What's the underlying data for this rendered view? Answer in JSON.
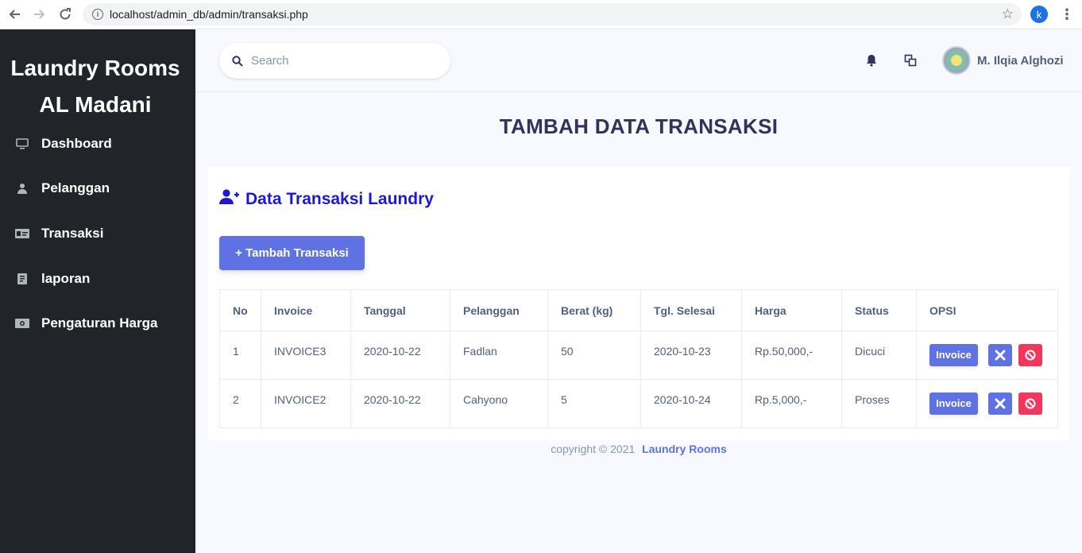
{
  "browser": {
    "url": "localhost/admin_db/admin/transaksi.php",
    "profile_initial": "k"
  },
  "sidebar": {
    "brand_line1": "Laundry Rooms",
    "brand_line2": "AL Madani",
    "items": [
      {
        "label": "Dashboard",
        "icon": "monitor-icon"
      },
      {
        "label": "Pelanggan",
        "icon": "user-icon"
      },
      {
        "label": "Transaksi",
        "icon": "money-card-icon"
      },
      {
        "label": "laporan",
        "icon": "report-icon"
      },
      {
        "label": "Pengaturan Harga",
        "icon": "cash-icon"
      }
    ]
  },
  "topbar": {
    "search_placeholder": "Search",
    "user_name": "M. Ilqia Alghozi"
  },
  "page_title": "TAMBAH DATA TRANSAKSI",
  "card": {
    "title": "Data Transaksi Laundry",
    "add_button": "+ Tambah Transaksi"
  },
  "table": {
    "headers": [
      "No",
      "Invoice",
      "Tanggal",
      "Pelanggan",
      "Berat (kg)",
      "Tgl. Selesai",
      "Harga",
      "Status",
      "OPSI"
    ],
    "rows": [
      {
        "no": "1",
        "invoice": "INVOICE3",
        "tanggal": "2020-10-22",
        "pelanggan": "Fadlan",
        "berat": "50",
        "tgl_selesai": "2020-10-23",
        "harga": "Rp.50,000,-",
        "status": "Dicuci",
        "btn_invoice": "Invoice"
      },
      {
        "no": "2",
        "invoice": "INVOICE2",
        "tanggal": "2020-10-22",
        "pelanggan": "Cahyono",
        "berat": "5",
        "tgl_selesai": "2020-10-24",
        "harga": "Rp.5,000,-",
        "status": "Proses",
        "btn_invoice": "Invoice"
      }
    ]
  },
  "footer": {
    "text": "copyright © 2021",
    "link": "Laundry Rooms"
  },
  "colors": {
    "sidebar_bg": "#212529",
    "primary": "#5e72e4",
    "danger": "#f5365c",
    "card_title": "#1d18d8",
    "heading": "#32325d"
  }
}
